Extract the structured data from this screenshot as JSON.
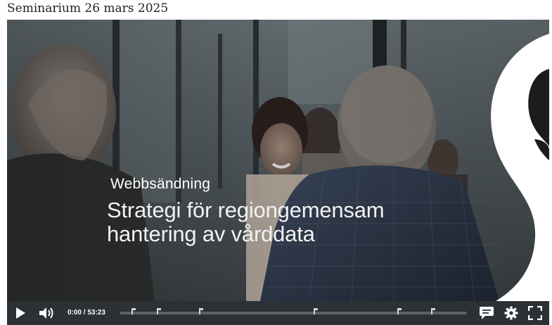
{
  "page": {
    "heading": "Seminarium 26 mars 2025"
  },
  "video": {
    "subtitle": "Webbsändning",
    "title_line1": "Strategi för regiongemensam",
    "title_line2": "hantering av vårddata",
    "logo_icon": "s-logo-icon",
    "brand_color": "#ffffff"
  },
  "controls": {
    "play_icon": "play-icon",
    "volume_icon": "volume-icon",
    "time_display": "0:00 / 53:23",
    "progress_fraction": 0.0,
    "chapter_count": 7,
    "captions_icon": "captions-icon",
    "settings_icon": "gear-icon",
    "fullscreen_icon": "fullscreen-icon",
    "accent_color": "#ffffff",
    "bar_color": "#2c3135"
  }
}
